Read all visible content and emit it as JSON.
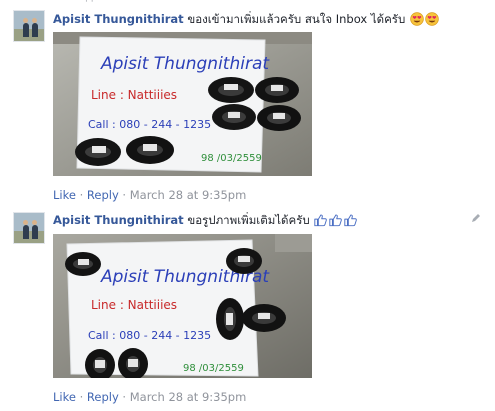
{
  "comments": [
    {
      "author": "Apisit Thungnithirat",
      "text": "ของเข้ามาเพิ่มแล้วครับ สนใจ Inbox ได้ครับ",
      "emoji": [
        "heart-eyes-icon",
        "heart-eyes-icon"
      ],
      "photo": {
        "name": "Apisit Thungnithirat",
        "line": "Line : Nattiiies",
        "call": "Call : 080 - 244 - 1235",
        "date": "98 /03/2559"
      },
      "like_label": "Like",
      "reply_label": "Reply",
      "time": "March 28 at 9:35pm"
    },
    {
      "author": "Apisit Thungnithirat",
      "text": "ขอรูปภาพเพิ่มเติมได้ครับ",
      "emoji": [
        "thumbs-up-icon",
        "thumbs-up-icon",
        "thumbs-up-icon"
      ],
      "photo": {
        "name": "Apisit Thungnithirat",
        "line": "Line : Nattiiies",
        "call": "Call : 080 - 244 - 1235",
        "date": "98 /03/2559"
      },
      "like_label": "Like",
      "reply_label": "Reply",
      "time": "March 28 at 9:35pm"
    }
  ],
  "separator": "·",
  "colors": {
    "author": "#365899",
    "link": "#4267b2",
    "meta": "#90949c",
    "ink_blue": "#2b3fb8",
    "ink_red": "#c8292a",
    "ink_green": "#2f8f3b"
  }
}
